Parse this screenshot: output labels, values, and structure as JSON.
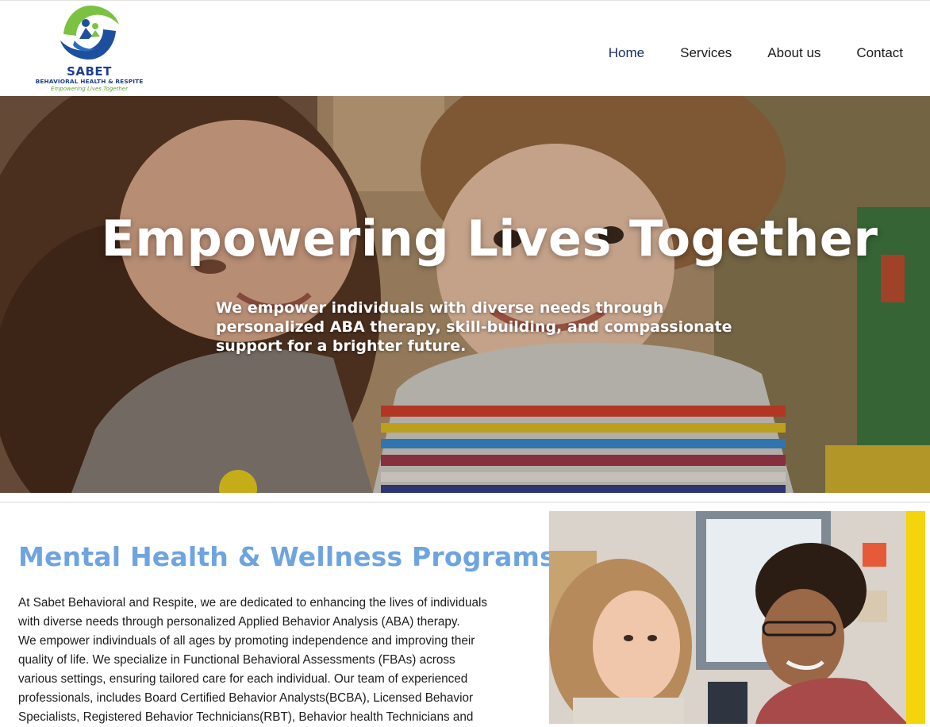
{
  "header": {
    "logo": {
      "name": "SABET",
      "subtitle": "BEHAVIORAL HEALTH & RESPITE",
      "tagline": "Empowering Lives Together"
    },
    "nav": [
      {
        "label": "Home",
        "active": true
      },
      {
        "label": "Services",
        "active": false
      },
      {
        "label": "About us",
        "active": false
      },
      {
        "label": "Contact",
        "active": false
      }
    ]
  },
  "hero": {
    "title": "Empowering Lives Together",
    "subtitle": "We empower individuals with diverse needs through personalized ABA therapy, skill-building, and compassionate support for a brighter future."
  },
  "programs": {
    "title": "Mental Health & Wellness Programs",
    "paragraph_line1": "At Sabet Behavioral and Respite, we are dedicated to enhancing the lives of individuals with diverse needs through personalized Applied Behavior Analysis (ABA) therapy.",
    "paragraph_line2": "We empower indivinduals of all ages by promoting independence and improving their quality of life. We specialize in Functional Behavioral Assessments (FBAs) across various settings, ensuring tailored care for each individual. Our team of experienced professionals, includes Board Certified Behavior Analysts(BCBA), Licensed Behavior Specialists, Registered Behavior Technicians(RBT), Behavior health Technicians and"
  },
  "colors": {
    "accent_blue": "#6ea4e0",
    "brand_navy": "#1d3f8f",
    "brand_green": "#5aa52a",
    "accent_yellow": "#f4d40a"
  }
}
